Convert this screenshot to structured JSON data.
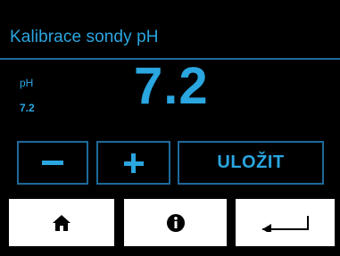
{
  "screen": {
    "title": "Kalibrace sondy pH"
  },
  "measurement": {
    "param_label": "pH",
    "current_value": "7.2",
    "set_value": "7.2"
  },
  "controls": {
    "minus_icon": "minus-icon",
    "plus_icon": "plus-icon",
    "save_label": "ULOŽIT"
  },
  "nav": {
    "home_icon": "home-icon",
    "info_icon": "info-icon",
    "back_icon": "return-arrow-icon"
  },
  "colors": {
    "background": "#000000",
    "accent": "#2aa6e0",
    "border": "#1e6a9a",
    "nav_button": "#ffffff",
    "nav_icon": "#000000"
  }
}
